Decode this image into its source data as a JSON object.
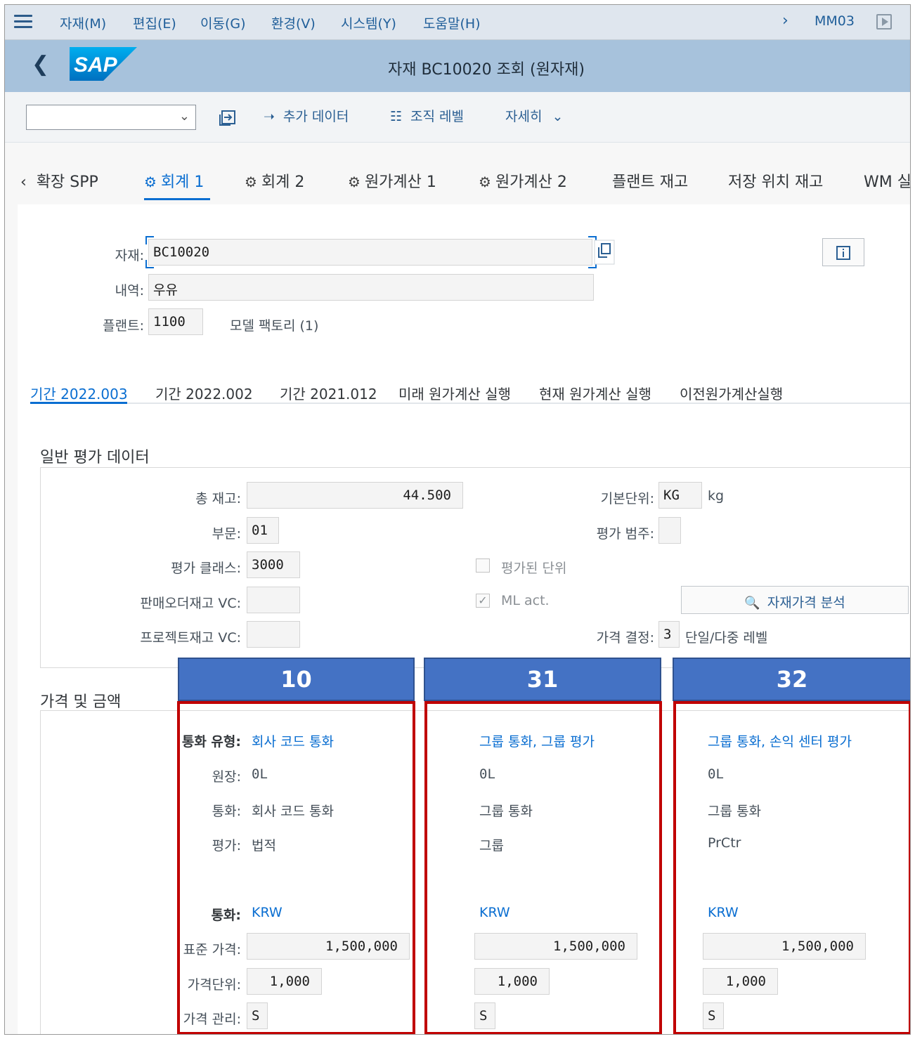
{
  "menu": {
    "items": [
      "자재(M)",
      "편집(E)",
      "이동(G)",
      "환경(V)",
      "시스템(Y)",
      "도움말(H)"
    ],
    "tcode": "MM03"
  },
  "header": {
    "title": "자재 BC10020 조회 (원자재)",
    "logo_text": "SAP"
  },
  "toolbar": {
    "additional_data": "추가 데이터",
    "org_levels": "조직 레벨",
    "more": "자세히"
  },
  "tabs": [
    "확장 SPP",
    "회계 1",
    "회계 2",
    "원가계산 1",
    "원가계산 2",
    "플랜트 재고",
    "저장 위치 재고",
    "WM 실"
  ],
  "material": {
    "material_label": "자재:",
    "material_value": "BC10020",
    "desc_label": "내역:",
    "desc_value": "우유",
    "plant_label": "플랜트:",
    "plant_value": "1100",
    "plant_name": "모델 팩토리 (1)"
  },
  "period_tabs": [
    "기간 2022.003",
    "기간 2022.002",
    "기간 2021.012",
    "미래 원가계산 실행",
    "현재 원가계산 실행",
    "이전원가계산실행"
  ],
  "general": {
    "title": "일반 평가 데이터",
    "total_stock_label": "총 재고:",
    "total_stock": "44.500",
    "division_label": "부문:",
    "division": "01",
    "valclass_label": "평가 클래스:",
    "valclass": "3000",
    "sales_vc_label": "판매오더재고 VC:",
    "sales_vc": "",
    "proj_vc_label": "프로젝트재고 VC:",
    "proj_vc": "",
    "base_unit_label": "기본단위:",
    "base_unit": "KG",
    "base_unit_text": "kg",
    "val_cat_label": "평가 범주:",
    "val_cat": "",
    "valuated_unit_label": "평가된 단위",
    "valuated_unit_checked": false,
    "ml_act_label": "ML act.",
    "ml_act_checked": true,
    "price_analysis_button": "자재가격 분석",
    "price_det_label": "가격 결정:",
    "price_det": "3",
    "price_det_text": "단일/다중 레벨"
  },
  "prices": {
    "title": "가격 및 금액",
    "labels": {
      "currency_type": "통화 유형:",
      "ledger": "원장:",
      "currency": "통화:",
      "valuation": "평가:",
      "currency2": "통화:",
      "std_price": "표준 가격:",
      "price_unit": "가격단위:",
      "price_control": "가격 관리:"
    },
    "columns": [
      {
        "code": "10",
        "currency_type": "회사 코드 통화",
        "ledger": "0L",
        "currency": "회사 코드 통화",
        "valuation": "법적",
        "currency_key": "KRW",
        "std_price": "1,500,000",
        "price_unit": "1,000",
        "price_control": "S"
      },
      {
        "code": "31",
        "currency_type": "그룹 통화, 그룹 평가",
        "ledger": "0L",
        "currency": "그룹 통화",
        "valuation": "그룹",
        "currency_key": "KRW",
        "std_price": "1,500,000",
        "price_unit": "1,000",
        "price_control": "S"
      },
      {
        "code": "32",
        "currency_type": "그룹 통화, 손익 센터 평가",
        "ledger": "0L",
        "currency": "그룹 통화",
        "valuation": "PrCtr",
        "currency_key": "KRW",
        "std_price": "1,500,000",
        "price_unit": "1,000",
        "price_control": "S"
      }
    ]
  },
  "colors": {
    "accent": "#0a6ed1",
    "header_band": "#a7c2dc",
    "highlight_header": "#4472c4",
    "highlight_border": "#c00000"
  }
}
